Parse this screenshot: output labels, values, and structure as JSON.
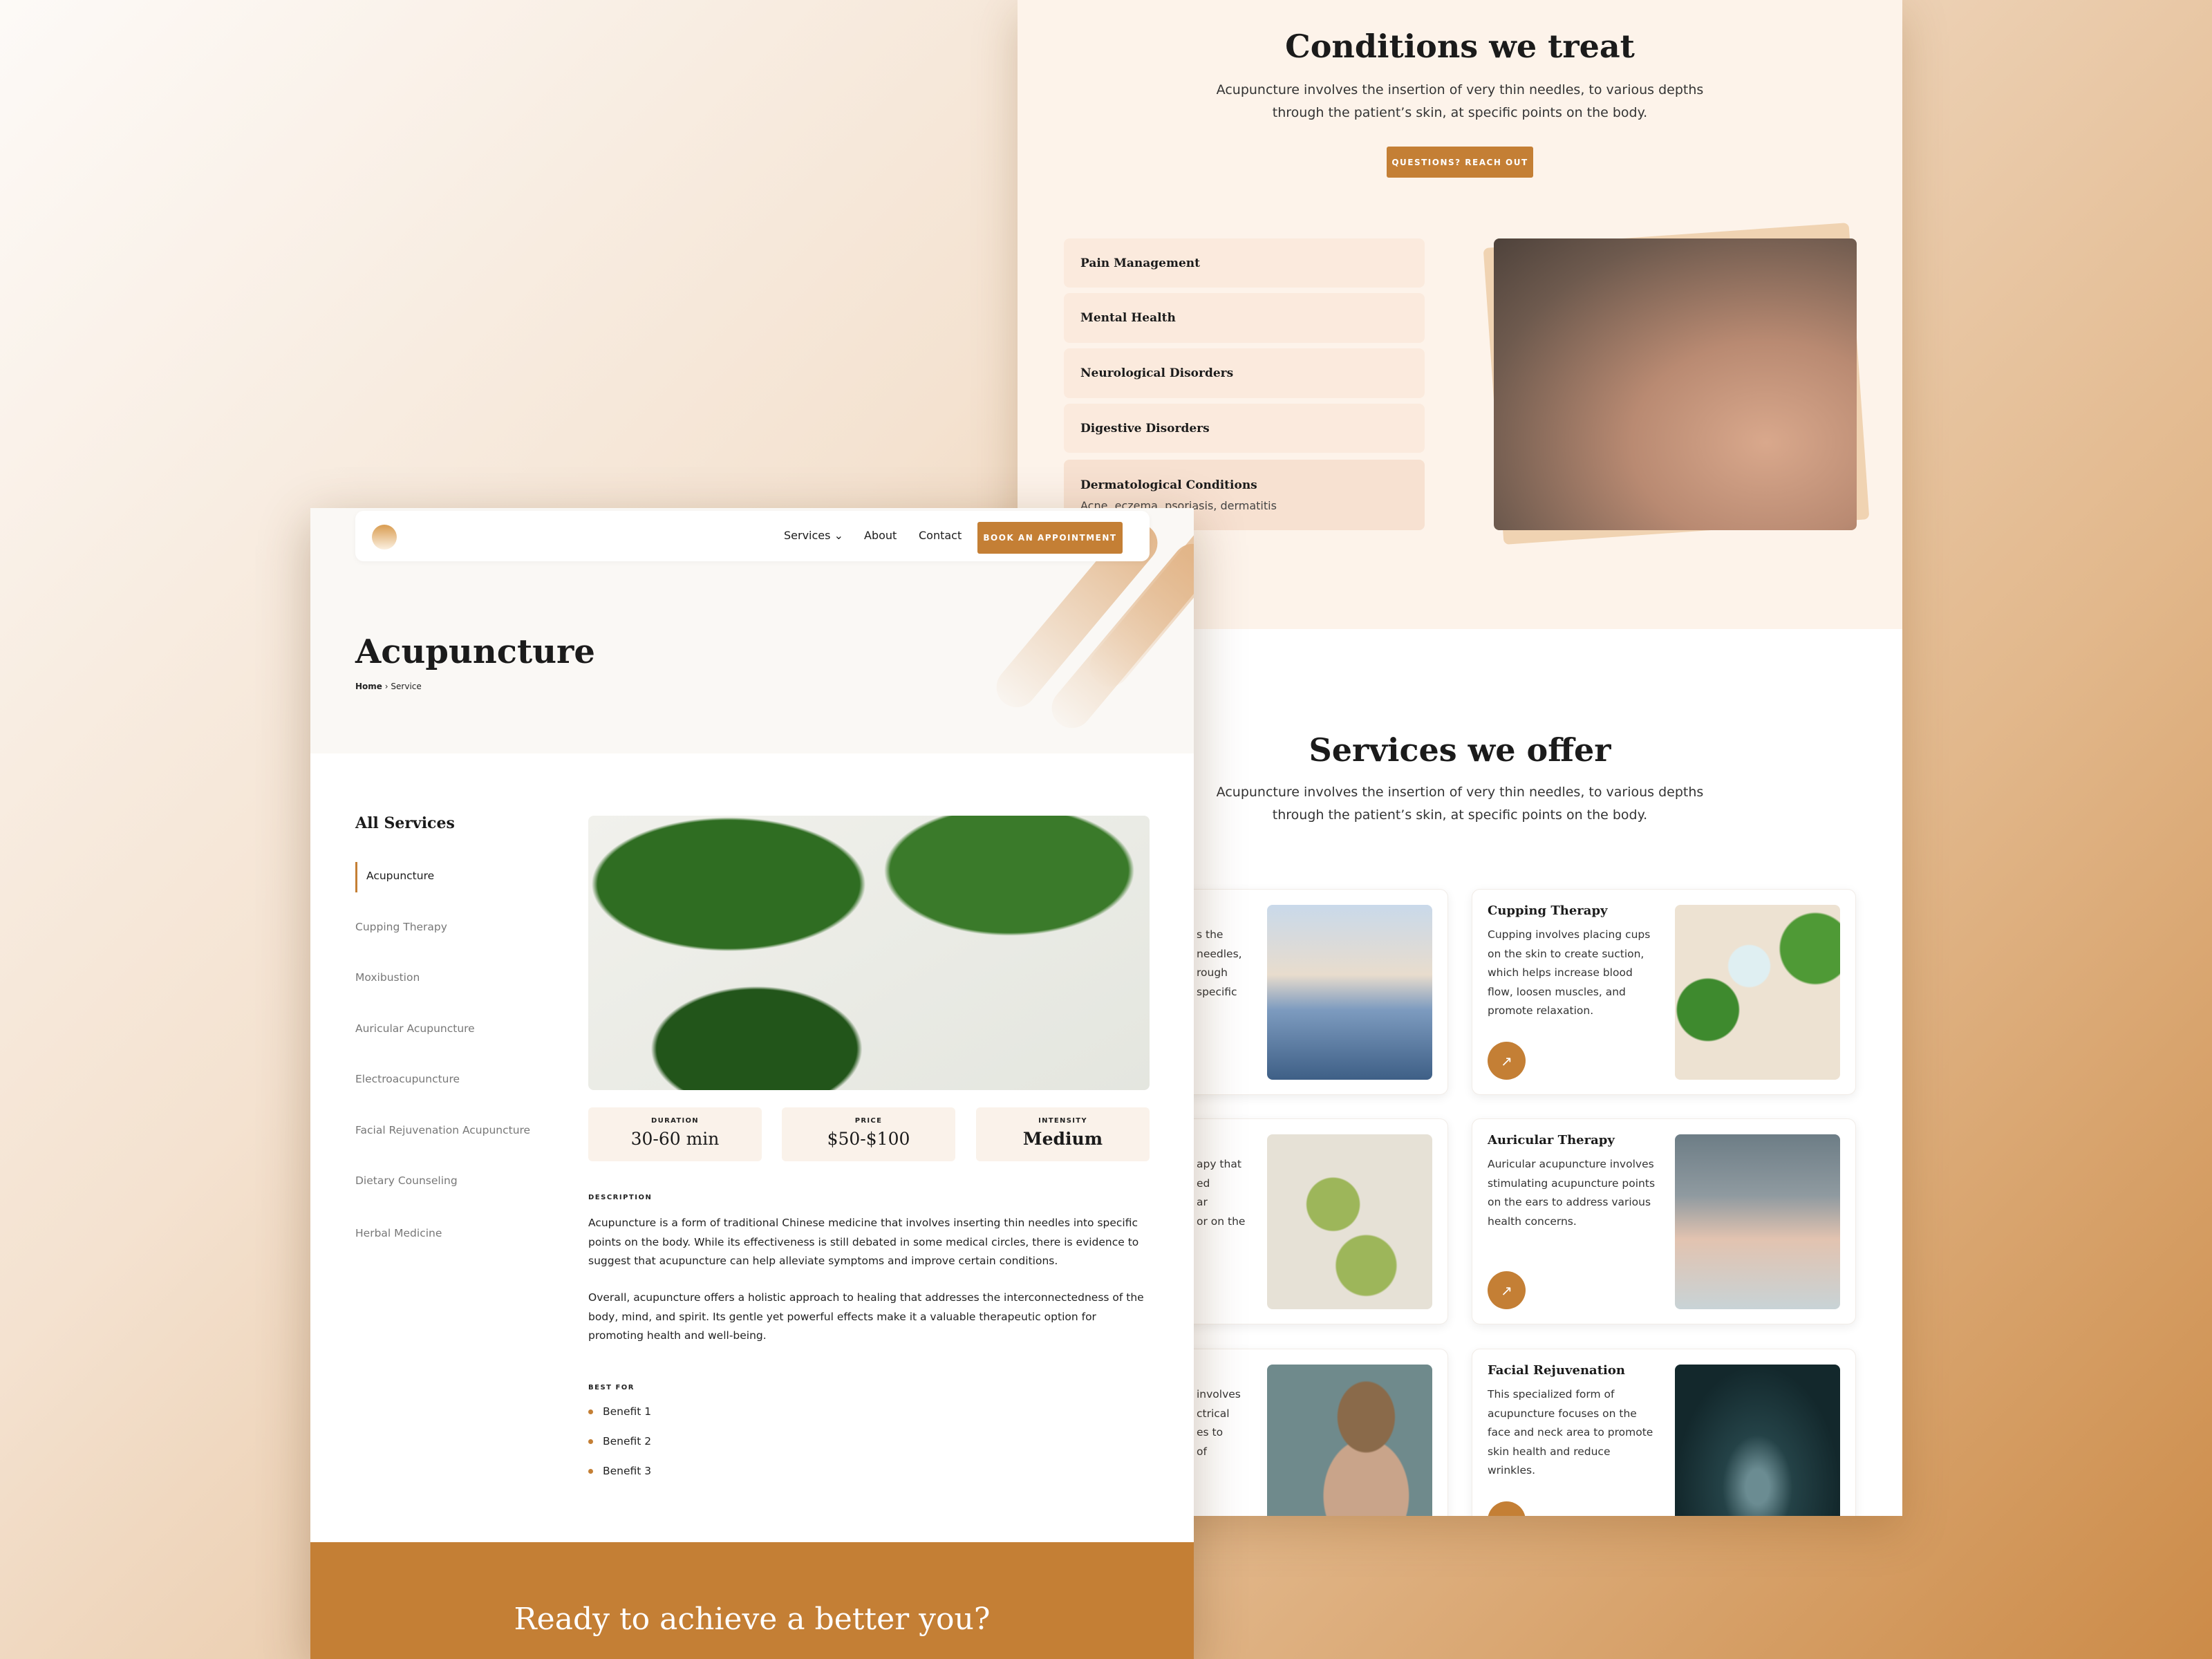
{
  "conditions": {
    "title": "Conditions we treat",
    "subtitle_l1": "Acupuncture involves the insertion of very thin needles, to various depths",
    "subtitle_l2": "through the patient’s skin, at specific points on the body.",
    "button": "QUESTIONS? REACH OUT",
    "items": [
      {
        "title": "Pain Management"
      },
      {
        "title": "Mental Health"
      },
      {
        "title": "Neurological Disorders"
      },
      {
        "title": "Digestive Disorders"
      },
      {
        "title": "Dermatological Conditions",
        "desc": "Acne, eczema, psoriasis, dermatitis"
      }
    ]
  },
  "services": {
    "title": "Services we offer",
    "subtitle_l1": "Acupuncture involves the insertion of very thin needles, to various depths",
    "subtitle_l2": "through the patient’s skin, at specific points on the body.",
    "left_fragments": [
      [
        "s the",
        "needles,",
        "rough",
        "specific"
      ],
      [
        "apy that",
        "ed",
        "ar",
        "or on the"
      ],
      [
        "involves",
        "ctrical",
        "es to",
        "of"
      ]
    ],
    "cards": [
      {
        "title": "Cupping Therapy",
        "desc": "Cupping involves placing cups on the skin to create suction, which helps increase blood flow, loosen muscles, and promote relaxation."
      },
      {
        "title": "Auricular Therapy",
        "desc": "Auricular acupuncture involves stimulating acupuncture points on the ears to address various health concerns."
      },
      {
        "title": "Facial Rejuvenation",
        "desc": "This specialized form of acupuncture focuses on the face and neck area to promote skin health and reduce wrinkles."
      }
    ],
    "arrow_icon": "↗"
  },
  "nav": {
    "services": "Services",
    "chevron": "⌄",
    "about": "About",
    "contact": "Contact",
    "cta": "BOOK AN APPOINTMENT"
  },
  "hero": {
    "title": "Acupuncture",
    "breadcrumb": {
      "home": "Home",
      "sep": "›",
      "current": "Service"
    }
  },
  "sidebar": {
    "title": "All Services",
    "items": [
      "Acupuncture",
      "Cupping Therapy",
      "Moxibustion",
      "Auricular Acupuncture",
      "Electroacupuncture",
      "Facial Rejuvenation Acupuncture",
      "Dietary Counseling",
      "Herbal Medicine"
    ],
    "active": 0
  },
  "stats": [
    {
      "label": "DURATION",
      "value": "30-60 min"
    },
    {
      "label": "PRICE",
      "value": "$50-$100"
    },
    {
      "label": "INTENSITY",
      "value": "Medium"
    }
  ],
  "description": {
    "label": "DESCRIPTION",
    "p1": "Acupuncture is a form of traditional Chinese medicine that involves inserting thin needles into specific points on the body. While its effectiveness is still debated in some medical circles, there is evidence to suggest that acupuncture can help alleviate symptoms and improve certain conditions.",
    "p2": "Overall, acupuncture offers a holistic approach to healing that addresses the interconnectedness of the body, mind, and spirit. Its gentle yet powerful effects make it a valuable therapeutic option for promoting health and well-being."
  },
  "best_for": {
    "label": "BEST FOR",
    "items": [
      "Benefit 1",
      "Benefit 2",
      "Benefit 3"
    ]
  },
  "cta": {
    "title": "Ready to achieve a better you?"
  },
  "colors": {
    "accent": "#c47f35",
    "cream": "#fdf3ea",
    "tile": "#fbeadd"
  }
}
